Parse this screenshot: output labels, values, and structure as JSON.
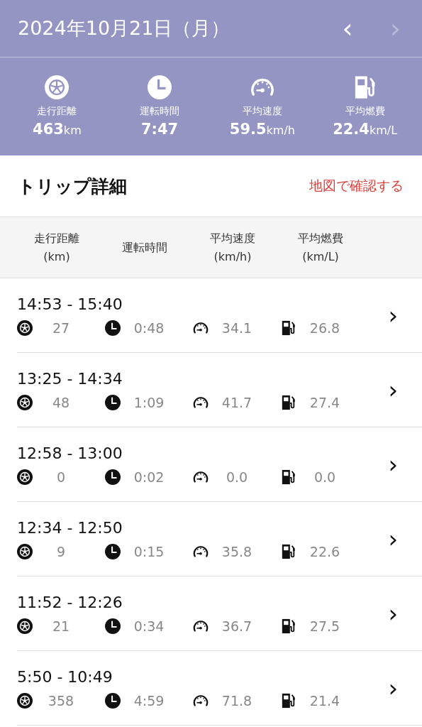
{
  "header": {
    "date": "2024年10月21日（月）",
    "prev_button": {
      "label": "‹",
      "disabled": false
    },
    "next_button": {
      "label": "›",
      "disabled": true
    }
  },
  "summary": [
    {
      "kind": "tire",
      "label": "走行距離",
      "value": "463",
      "unit": "km"
    },
    {
      "kind": "clock",
      "label": "運転時間",
      "value": "7:47"
    },
    {
      "kind": "gauge",
      "label": "平均速度",
      "value": "59.5",
      "unit": "km/h"
    },
    {
      "kind": "fuel",
      "label": "平均燃費",
      "value": "22.4",
      "unit": "km/L"
    }
  ],
  "section": {
    "title": "トリップ詳細",
    "map_link": "地図で確認する"
  },
  "columns": [
    "走行距離\n(km)",
    "運転時間",
    "平均速度\n(km/h)",
    "平均燃費\n(km/L)"
  ],
  "trips": [
    {
      "time": "14:53 - 15:40",
      "distance": "27",
      "duration": "0:48",
      "speed": "34.1",
      "economy": "26.8",
      "chevron": "›"
    },
    {
      "time": "13:25 - 14:34",
      "distance": "48",
      "duration": "1:09",
      "speed": "41.7",
      "economy": "27.4",
      "chevron": "›"
    },
    {
      "time": "12:58 - 13:00",
      "distance": "0",
      "duration": "0:02",
      "speed": "0.0",
      "economy": "0.0",
      "chevron": "›"
    },
    {
      "time": "12:34 - 12:50",
      "distance": "9",
      "duration": "0:15",
      "speed": "35.8",
      "economy": "22.6",
      "chevron": "›"
    },
    {
      "time": "11:52 - 12:26",
      "distance": "21",
      "duration": "0:34",
      "speed": "36.7",
      "economy": "27.5",
      "chevron": "›"
    },
    {
      "time": "5:50 - 10:49",
      "distance": "358",
      "duration": "4:59",
      "speed": "71.8",
      "economy": "21.4",
      "chevron": "›"
    }
  ]
}
